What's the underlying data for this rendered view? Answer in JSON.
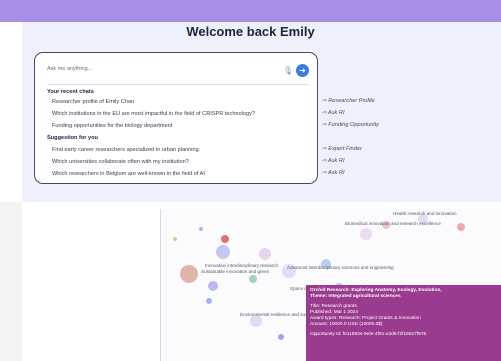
{
  "header": {
    "welcome": "Welcome back Emily"
  },
  "search": {
    "placeholder": "Ask me anything..."
  },
  "icons": {
    "mic": "microphone-icon",
    "send": "arrow-right-icon"
  },
  "recent": {
    "title": "Your recent chats",
    "items": [
      {
        "label": "Researcher profile of Emily Chan",
        "hint": "⇨ Researcher Profile"
      },
      {
        "label": "Which institutions in the EU are most impactful in the field of CRISPR technology?",
        "hint": "⇨ Ask RI"
      },
      {
        "label": "Funding opportunities for the biology department",
        "hint": "⇨ Funding Opportunity"
      }
    ]
  },
  "suggestions": {
    "title": "Suggestion for you",
    "items": [
      {
        "label": "Find early career researchers specialized in urban planning.",
        "hint": "⇨ Expert Finder"
      },
      {
        "label": "Which universities collaborate often with my institution?",
        "hint": "⇨ Ask RI"
      },
      {
        "label": "Which researchers in Belgium are well-known in the field of AI",
        "hint": "⇨ Ask RI"
      }
    ]
  },
  "viz": {
    "labels": [
      "Health research and innovation",
      "Biomedical innovation and research excellence",
      "Innovative interdisciplinary research",
      "Sustainable innovation and green",
      "Advanced interdisciplinary sciences and engineering",
      "Space and earth",
      "Environmental resilience and sustainability"
    ]
  },
  "tooltip": {
    "title": "Orchid Research: Exploring Anatomy, Ecology, Evolution,",
    "theme": "Theme: Integrated agricultural sciences",
    "type": "Title: Research grants",
    "published": "Published: Mar 1 2024",
    "award": "Award types: Research: Project Grants & Innovation",
    "amount": "Amount: 10000.0 USD (10000.0$)",
    "opportunity": "Opportunity Id: fe119834-9efe-4f81-a3d9-f2f15527f976"
  },
  "colors": {
    "accent": "#a98ee8",
    "panel": "#eef0fb",
    "send": "#3d7be0",
    "tooltip": "#9a3b8f"
  }
}
